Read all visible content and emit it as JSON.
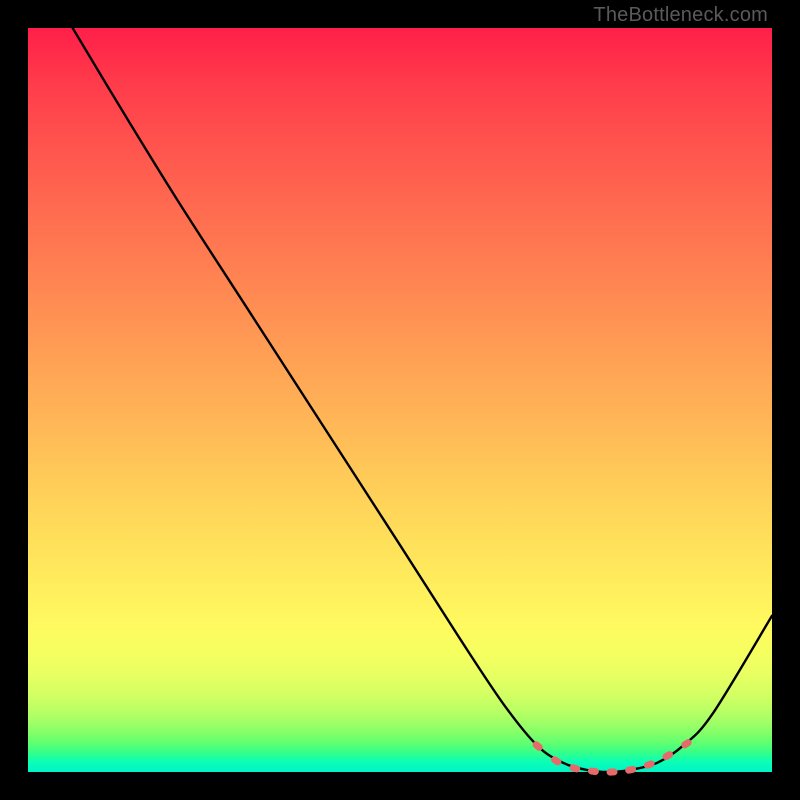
{
  "watermark": "TheBottleneck.com",
  "chart_data": {
    "type": "line",
    "title": "",
    "xlabel": "",
    "ylabel": "",
    "xlim": [
      0,
      1
    ],
    "ylim": [
      0,
      1
    ],
    "series": [
      {
        "name": "bottleneck-curve",
        "x": [
          0.06,
          0.12,
          0.2,
          0.3,
          0.4,
          0.5,
          0.58,
          0.64,
          0.685,
          0.72,
          0.75,
          0.78,
          0.81,
          0.845,
          0.88,
          0.92,
          1.0
        ],
        "y": [
          1.0,
          0.9,
          0.77,
          0.615,
          0.46,
          0.305,
          0.18,
          0.09,
          0.035,
          0.012,
          0.003,
          0.0,
          0.003,
          0.012,
          0.035,
          0.078,
          0.21
        ]
      }
    ],
    "highlight": {
      "name": "optimal-range",
      "x": [
        0.685,
        0.71,
        0.735,
        0.76,
        0.785,
        0.81,
        0.835,
        0.86,
        0.885
      ],
      "y": [
        0.035,
        0.015,
        0.005,
        0.001,
        0.0,
        0.003,
        0.01,
        0.022,
        0.038
      ]
    },
    "colors": {
      "curve": "#010101",
      "highlight": "#e66a6a"
    }
  }
}
